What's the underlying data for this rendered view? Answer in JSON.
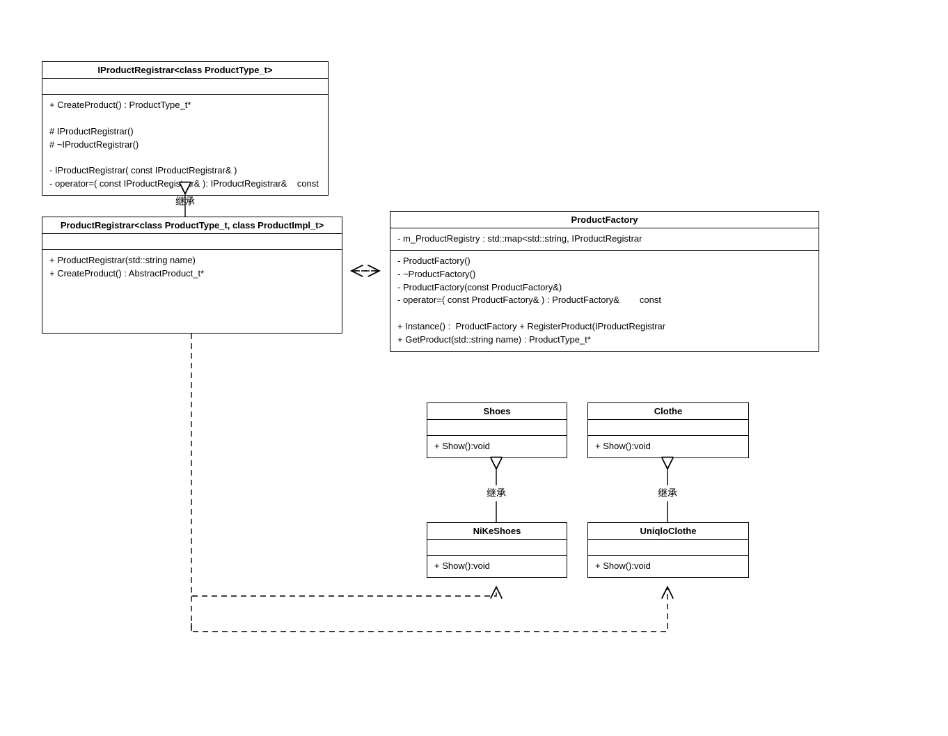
{
  "classes": {
    "iProductRegistrar": {
      "name": "IProductRegistrar<class ProductType_t>",
      "members": [
        "+ CreateProduct() : ProductType_t*",
        "",
        "# IProductRegistrar()",
        "# ~IProductRegistrar()",
        "",
        "- IProductRegistrar( const IProductRegistrar& )",
        "- operator=( const IProductRegistrar& ): IProductRegistrar&    const"
      ]
    },
    "productRegistrar": {
      "name": "ProductRegistrar<class ProductType_t, class ProductImpl_t>",
      "members": [
        "+ ProductRegistrar(std::string name)",
        "+ CreateProduct() : AbstractProduct_t*"
      ]
    },
    "productFactory": {
      "name": "ProductFactory",
      "attrs": [
        "- m_ProductRegistry : std::map<std::string, IProductRegistrar"
      ],
      "members": [
        "- ProductFactory()",
        "- ~ProductFactory()",
        "- ProductFactory(const ProductFactory&)",
        "- operator=( const ProductFactory& ) : ProductFactory&        const",
        "",
        "+ Instance() :  ProductFactory + RegisterProduct(IProductRegistrar",
        "+ GetProduct(std::string name) : ProductType_t*"
      ]
    },
    "shoes": {
      "name": "Shoes",
      "members": [
        "+ Show():void"
      ]
    },
    "clothe": {
      "name": "Clothe",
      "members": [
        "+ Show():void"
      ]
    },
    "nikeShoes": {
      "name": "NiKeShoes",
      "members": [
        "+ Show():void"
      ]
    },
    "uniqloClothe": {
      "name": "UniqloClothe",
      "members": [
        "+ Show():void"
      ]
    }
  },
  "labels": {
    "inherit1": "继承",
    "inherit2": "继承",
    "inherit3": "继承"
  }
}
